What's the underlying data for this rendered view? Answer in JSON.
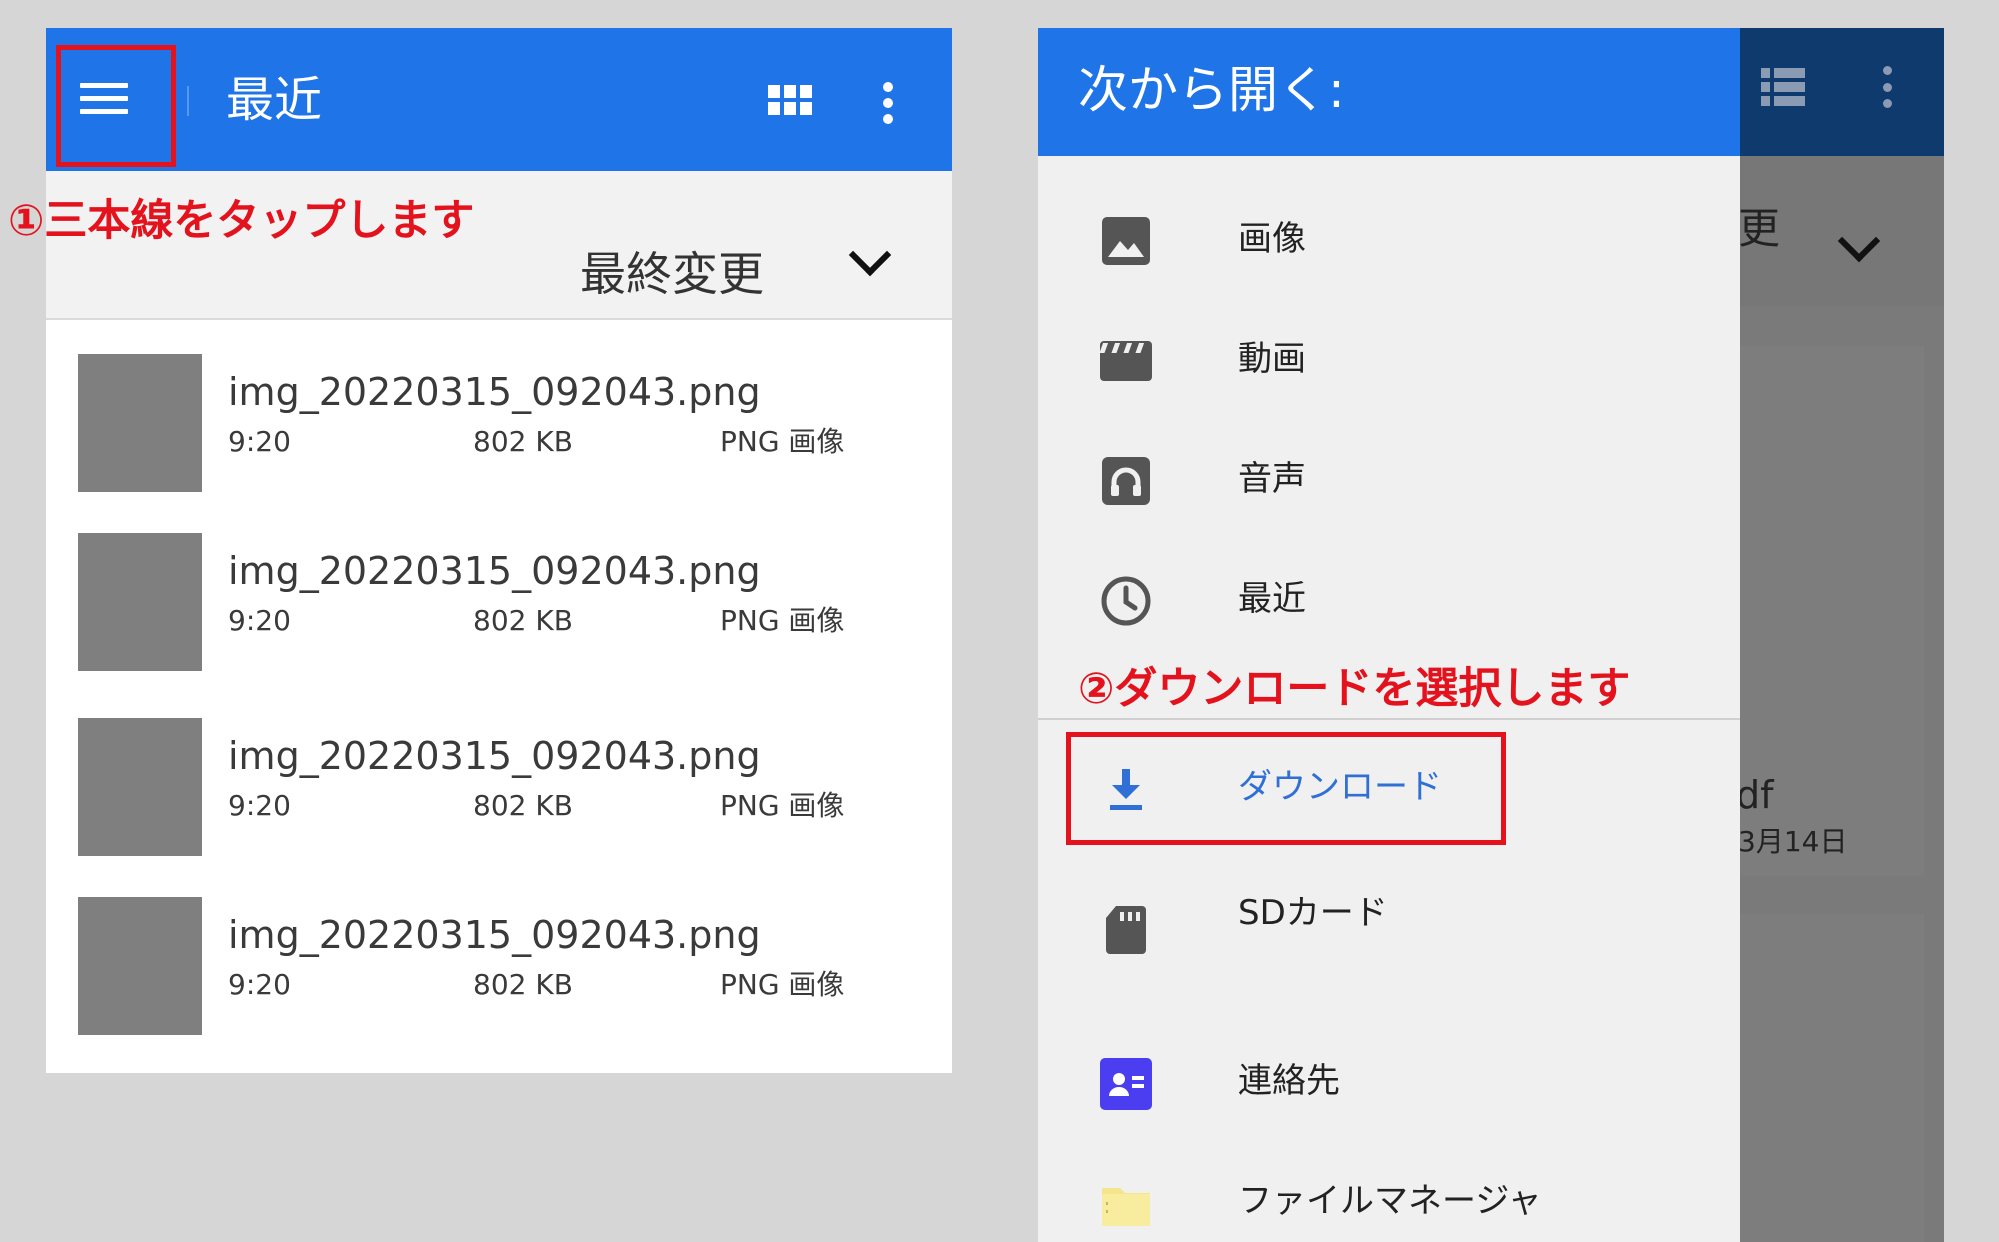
{
  "left": {
    "title": "最近",
    "annotation": "①三本線をタップします",
    "sort_label": "最終変更",
    "files": [
      {
        "name": "img_20220315_092043.png",
        "time": "9:20",
        "size": "802 KB",
        "type": "PNG 画像"
      },
      {
        "name": "img_20220315_092043.png",
        "time": "9:20",
        "size": "802 KB",
        "type": "PNG 画像"
      },
      {
        "name": "img_20220315_092043.png",
        "time": "9:20",
        "size": "802 KB",
        "type": "PNG 画像"
      },
      {
        "name": "img_20220315_092043.png",
        "time": "9:20",
        "size": "802 KB",
        "type": "PNG 画像"
      }
    ]
  },
  "right": {
    "drawer_title": "次から開く:",
    "annotation": "②ダウンロードを選択します",
    "items": [
      {
        "label": "画像",
        "icon": "image-icon"
      },
      {
        "label": "動画",
        "icon": "video-clapper-icon"
      },
      {
        "label": "音声",
        "icon": "headphones-icon"
      },
      {
        "label": "最近",
        "icon": "clock-icon"
      },
      {
        "label": "ダウンロード",
        "icon": "download-icon"
      },
      {
        "label": "SDカード",
        "icon": "sd-card-icon"
      },
      {
        "label": "連絡先",
        "icon": "contacts-icon"
      },
      {
        "label": "ファイルマネージャ",
        "icon": "folder-icon"
      }
    ],
    "background": {
      "partial_sort": "更",
      "partial_file": "df",
      "partial_date": "3月14日"
    }
  },
  "colors": {
    "appbar_blue": "#1f74e8",
    "annotation_red": "#e3121c",
    "download_blue": "#2f6fd6",
    "contacts_purple": "#4a3ef0",
    "folder_yellow": "#f4e58c"
  }
}
